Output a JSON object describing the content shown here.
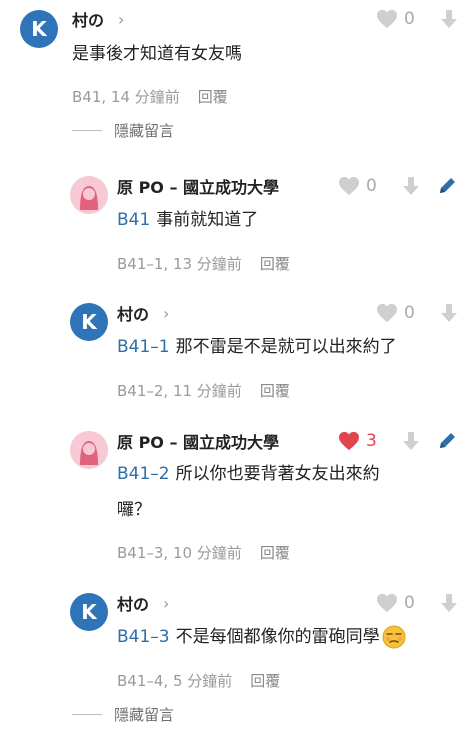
{
  "comments": [
    {
      "author": "村の",
      "avatar_letter": "K",
      "likes": "0",
      "liked": false,
      "reference": "",
      "text": "是事後才知道有女友嗎",
      "floor_time": "B41, 14 分鐘前",
      "reply_label": "回覆"
    },
    {
      "author": "原 PO – 國立成功大學",
      "likes": "0",
      "liked": false,
      "reference": "B41",
      "text": "事前就知道了",
      "floor_time": "B41–1, 13 分鐘前",
      "reply_label": "回覆"
    },
    {
      "author": "村の",
      "avatar_letter": "K",
      "likes": "0",
      "liked": false,
      "reference": "B41–1",
      "text": "那不雷是不是就可以出來約了",
      "floor_time": "B41–2, 11 分鐘前",
      "reply_label": "回覆"
    },
    {
      "author": "原 PO – 國立成功大學",
      "likes": "3",
      "liked": true,
      "reference": "B41–2",
      "text": "所以你也要背著女友出來約",
      "text_line2": "囉？",
      "floor_time": "B41–3, 10 分鐘前",
      "reply_label": "回覆"
    },
    {
      "author": "村の",
      "avatar_letter": "K",
      "likes": "0",
      "liked": false,
      "reference": "B41–3",
      "text": "不是每個都像你的雷砲同學",
      "emoji": "unamused-face-emoji",
      "floor_time": "B41–4, 5 分鐘前",
      "reply_label": "回覆"
    }
  ],
  "hidden_replies_label": "隱藏留言",
  "colors": {
    "link_blue": "#2f6fa8",
    "avatar_blue": "#2f74b8",
    "like_red": "#e0454b",
    "muted_gray": "#9a9a9a"
  }
}
